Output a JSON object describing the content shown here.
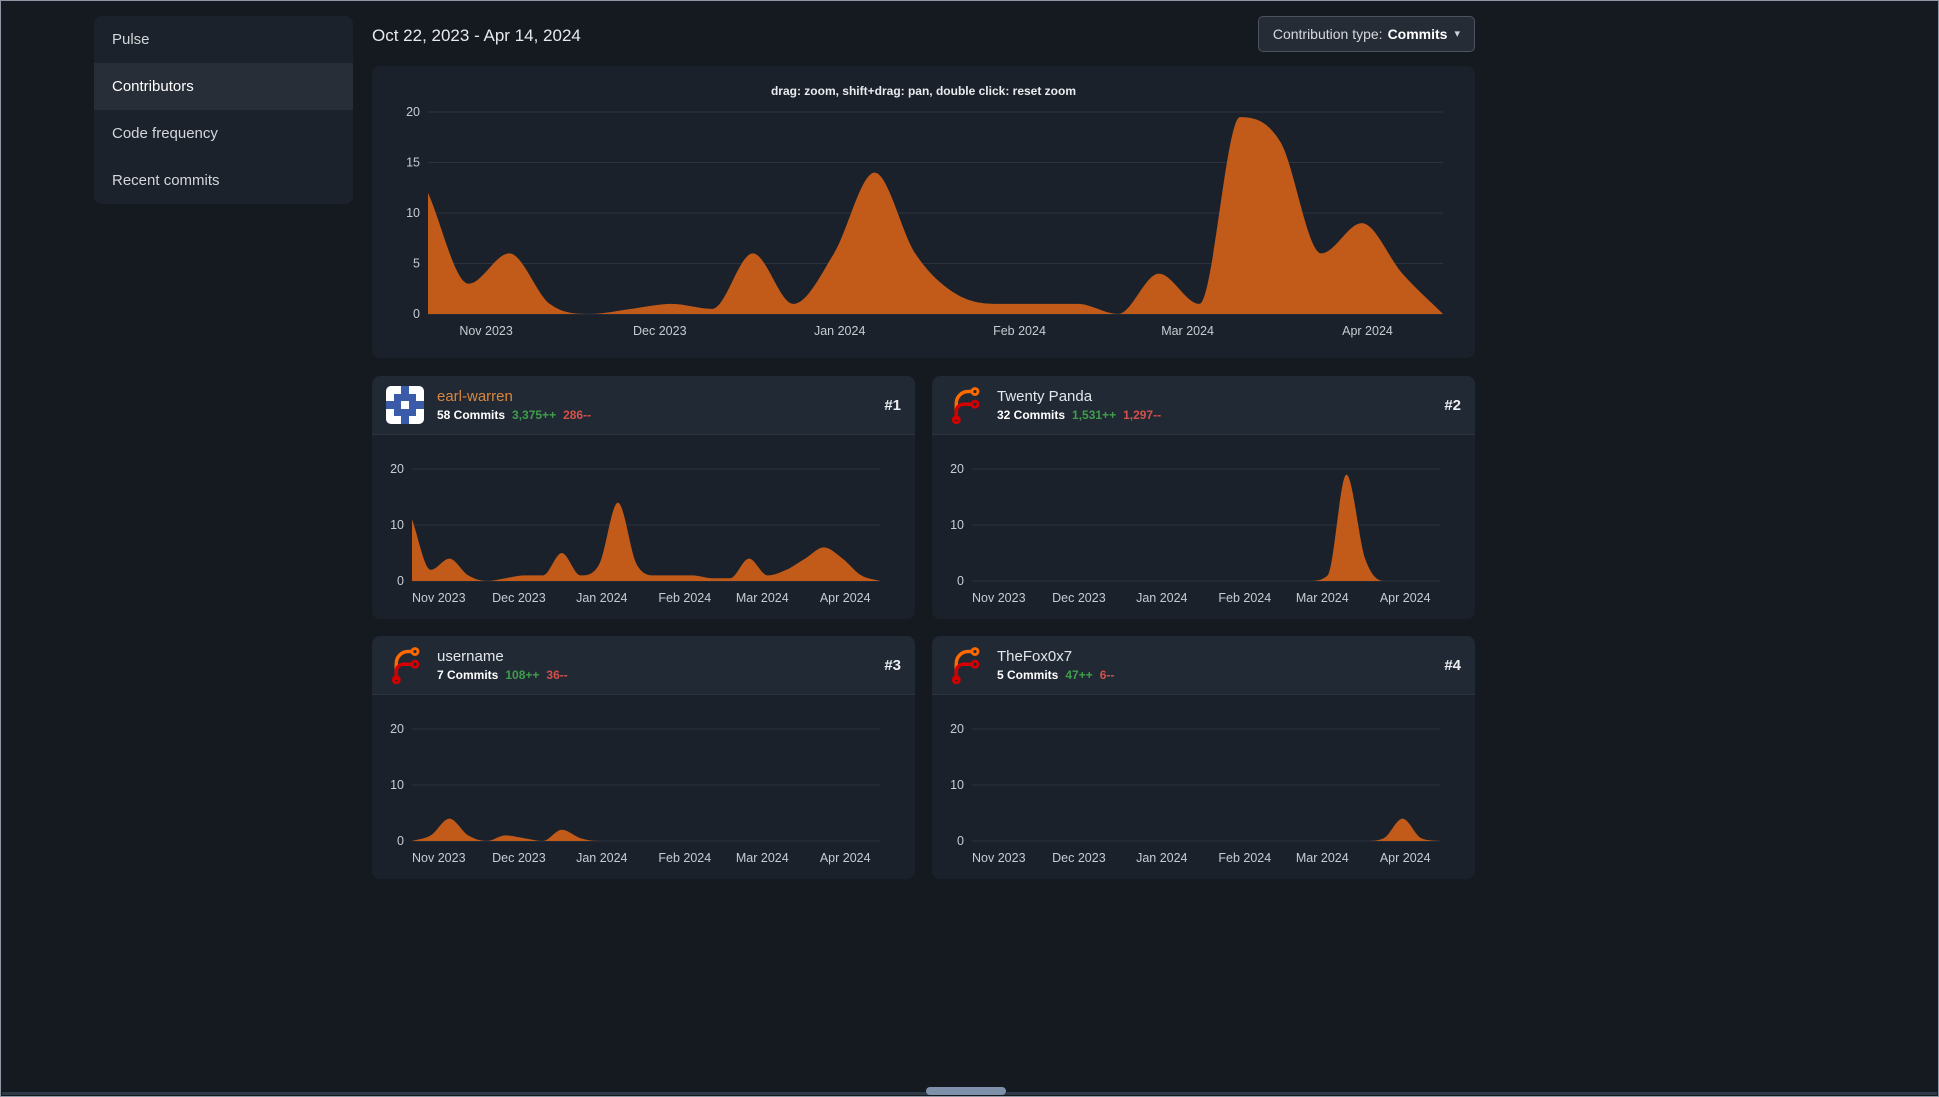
{
  "sidebar": {
    "items": [
      {
        "label": "Pulse",
        "active": false
      },
      {
        "label": "Contributors",
        "active": true
      },
      {
        "label": "Code frequency",
        "active": false
      },
      {
        "label": "Recent commits",
        "active": false
      }
    ]
  },
  "header": {
    "date_range": "Oct 22, 2023 - Apr 14, 2024",
    "contribution_type_label": "Contribution type:",
    "contribution_type_value": "Commits"
  },
  "main_chart": {
    "hint": "drag: zoom, shift+drag: pan, double click: reset zoom"
  },
  "contributors": [
    {
      "rank": "#1",
      "name": "earl-warren",
      "is_link": true,
      "commits": "58 Commits",
      "additions": "3,375++",
      "deletions": "286--",
      "avatar": "identicon",
      "identicon_bg": "#3a5ba9",
      "identicon_fg": "#ffffff",
      "identicon": [
        [
          1,
          1,
          0,
          1,
          1
        ],
        [
          1,
          0,
          0,
          0,
          1
        ],
        [
          0,
          0,
          1,
          0,
          0
        ],
        [
          1,
          0,
          0,
          0,
          1
        ],
        [
          1,
          1,
          0,
          1,
          1
        ]
      ]
    },
    {
      "rank": "#2",
      "name": "Twenty Panda",
      "is_link": false,
      "commits": "32 Commits",
      "additions": "1,531++",
      "deletions": "1,297--",
      "avatar": "forgejo-logo"
    },
    {
      "rank": "#3",
      "name": "username",
      "is_link": false,
      "commits": "7 Commits",
      "additions": "108++",
      "deletions": "36--",
      "avatar": "forgejo-logo"
    },
    {
      "rank": "#4",
      "name": "TheFox0x7",
      "is_link": false,
      "commits": "5 Commits",
      "additions": "47++",
      "deletions": "6--",
      "avatar": "forgejo-logo"
    }
  ],
  "colors": {
    "chart_fill": "#c25a1a",
    "link_orange": "#d9873c",
    "additions_green": "#3f9e4a",
    "deletions_red": "#d4504a"
  },
  "chart_data": [
    {
      "name": "overall-activity",
      "type": "area",
      "series": "commits per week",
      "values": [
        12,
        3,
        6,
        1,
        0,
        0.5,
        1,
        0.5,
        6,
        1,
        6,
        14,
        6,
        2,
        1,
        1,
        1,
        0,
        4,
        1,
        19.5,
        17,
        6,
        9,
        4,
        0
      ],
      "ylim": [
        0,
        20
      ],
      "y_ticks": [
        0,
        5,
        10,
        15,
        20
      ],
      "x_ticks": [
        {
          "label": "Nov 2023",
          "pos": 1.43
        },
        {
          "label": "Dec 2023",
          "pos": 5.71
        },
        {
          "label": "Jan 2024",
          "pos": 10.14
        },
        {
          "label": "Feb 2024",
          "pos": 14.57
        },
        {
          "label": "Mar 2024",
          "pos": 18.71
        },
        {
          "label": "Apr 2024",
          "pos": 23.14
        }
      ],
      "grid": "horizontal",
      "fill_color": "#c25a1a"
    },
    {
      "name": "earl-warren-activity",
      "type": "area",
      "series": "commits per week",
      "values": [
        11,
        2,
        4,
        1,
        0,
        0.5,
        1,
        1,
        5,
        1,
        3,
        14,
        3,
        1,
        1,
        1,
        0.5,
        0.5,
        4,
        1,
        2,
        4,
        6,
        4,
        1,
        0
      ],
      "ylim": [
        0,
        20
      ],
      "y_ticks": [
        0,
        10,
        20
      ],
      "x_ticks": [
        {
          "label": "Nov 2023",
          "pos": 1.43
        },
        {
          "label": "Dec 2023",
          "pos": 5.71
        },
        {
          "label": "Jan 2024",
          "pos": 10.14
        },
        {
          "label": "Feb 2024",
          "pos": 14.57
        },
        {
          "label": "Mar 2024",
          "pos": 18.71
        },
        {
          "label": "Apr 2024",
          "pos": 23.14
        }
      ],
      "grid": "horizontal",
      "fill_color": "#c25a1a"
    },
    {
      "name": "twenty-panda-activity",
      "type": "area",
      "series": "commits per week",
      "values": [
        0,
        0,
        0,
        0,
        0,
        0,
        0,
        0,
        0,
        0,
        0,
        0,
        0,
        0,
        0,
        0,
        0,
        0,
        0,
        1,
        19,
        4,
        0,
        0,
        0,
        0
      ],
      "ylim": [
        0,
        20
      ],
      "y_ticks": [
        0,
        10,
        20
      ],
      "x_ticks": [
        {
          "label": "Nov 2023",
          "pos": 1.43
        },
        {
          "label": "Dec 2023",
          "pos": 5.71
        },
        {
          "label": "Jan 2024",
          "pos": 10.14
        },
        {
          "label": "Feb 2024",
          "pos": 14.57
        },
        {
          "label": "Mar 2024",
          "pos": 18.71
        },
        {
          "label": "Apr 2024",
          "pos": 23.14
        }
      ],
      "grid": "horizontal",
      "fill_color": "#c25a1a"
    },
    {
      "name": "username-activity",
      "type": "area",
      "series": "commits per week",
      "values": [
        0,
        1,
        4,
        1,
        0,
        1,
        0.5,
        0,
        2,
        0.5,
        0,
        0,
        0,
        0,
        0,
        0,
        0,
        0,
        0,
        0,
        0,
        0,
        0,
        0,
        0,
        0
      ],
      "ylim": [
        0,
        20
      ],
      "y_ticks": [
        0,
        10,
        20
      ],
      "x_ticks": [
        {
          "label": "Nov 2023",
          "pos": 1.43
        },
        {
          "label": "Dec 2023",
          "pos": 5.71
        },
        {
          "label": "Jan 2024",
          "pos": 10.14
        },
        {
          "label": "Feb 2024",
          "pos": 14.57
        },
        {
          "label": "Mar 2024",
          "pos": 18.71
        },
        {
          "label": "Apr 2024",
          "pos": 23.14
        }
      ],
      "grid": "horizontal",
      "fill_color": "#c25a1a"
    },
    {
      "name": "thefox0x7-activity",
      "type": "area",
      "series": "commits per week",
      "values": [
        0,
        0,
        0,
        0,
        0,
        0,
        0,
        0,
        0,
        0,
        0,
        0,
        0,
        0,
        0,
        0,
        0,
        0,
        0,
        0,
        0,
        0,
        0.5,
        4,
        0.5,
        0
      ],
      "ylim": [
        0,
        20
      ],
      "y_ticks": [
        0,
        10,
        20
      ],
      "x_ticks": [
        {
          "label": "Nov 2023",
          "pos": 1.43
        },
        {
          "label": "Dec 2023",
          "pos": 5.71
        },
        {
          "label": "Jan 2024",
          "pos": 10.14
        },
        {
          "label": "Feb 2024",
          "pos": 14.57
        },
        {
          "label": "Mar 2024",
          "pos": 18.71
        },
        {
          "label": "Apr 2024",
          "pos": 23.14
        }
      ],
      "grid": "horizontal",
      "fill_color": "#c25a1a"
    }
  ]
}
